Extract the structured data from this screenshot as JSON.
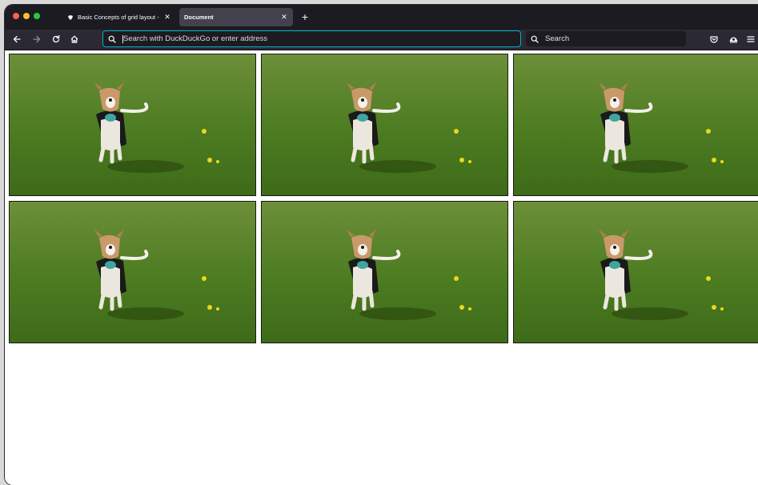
{
  "browser": {
    "tabs": [
      {
        "title": "Basic Concepts of grid layout - ",
        "favicon": "mdn-logo-icon",
        "active": false
      },
      {
        "title": "Document",
        "favicon": "",
        "active": true
      }
    ],
    "new_tab_icon": "plus-icon",
    "close_icon": "close-icon"
  },
  "toolbar": {
    "nav_icons": [
      "back-arrow-icon",
      "forward-arrow-icon",
      "reload-icon",
      "home-icon"
    ],
    "address_placeholder": "Search with DuckDuckGo or enter address",
    "search_placeholder": "Search",
    "right_icons": [
      "pocket-icon",
      "account-icon",
      "menu-icon"
    ],
    "accent_color": "#00b3c3"
  },
  "page": {
    "images": [
      {
        "subject": "dog running on grass"
      },
      {
        "subject": "dog running on grass"
      },
      {
        "subject": "dog running on grass"
      },
      {
        "subject": "dog running on grass"
      },
      {
        "subject": "dog running on grass"
      },
      {
        "subject": "dog running on grass"
      }
    ]
  }
}
